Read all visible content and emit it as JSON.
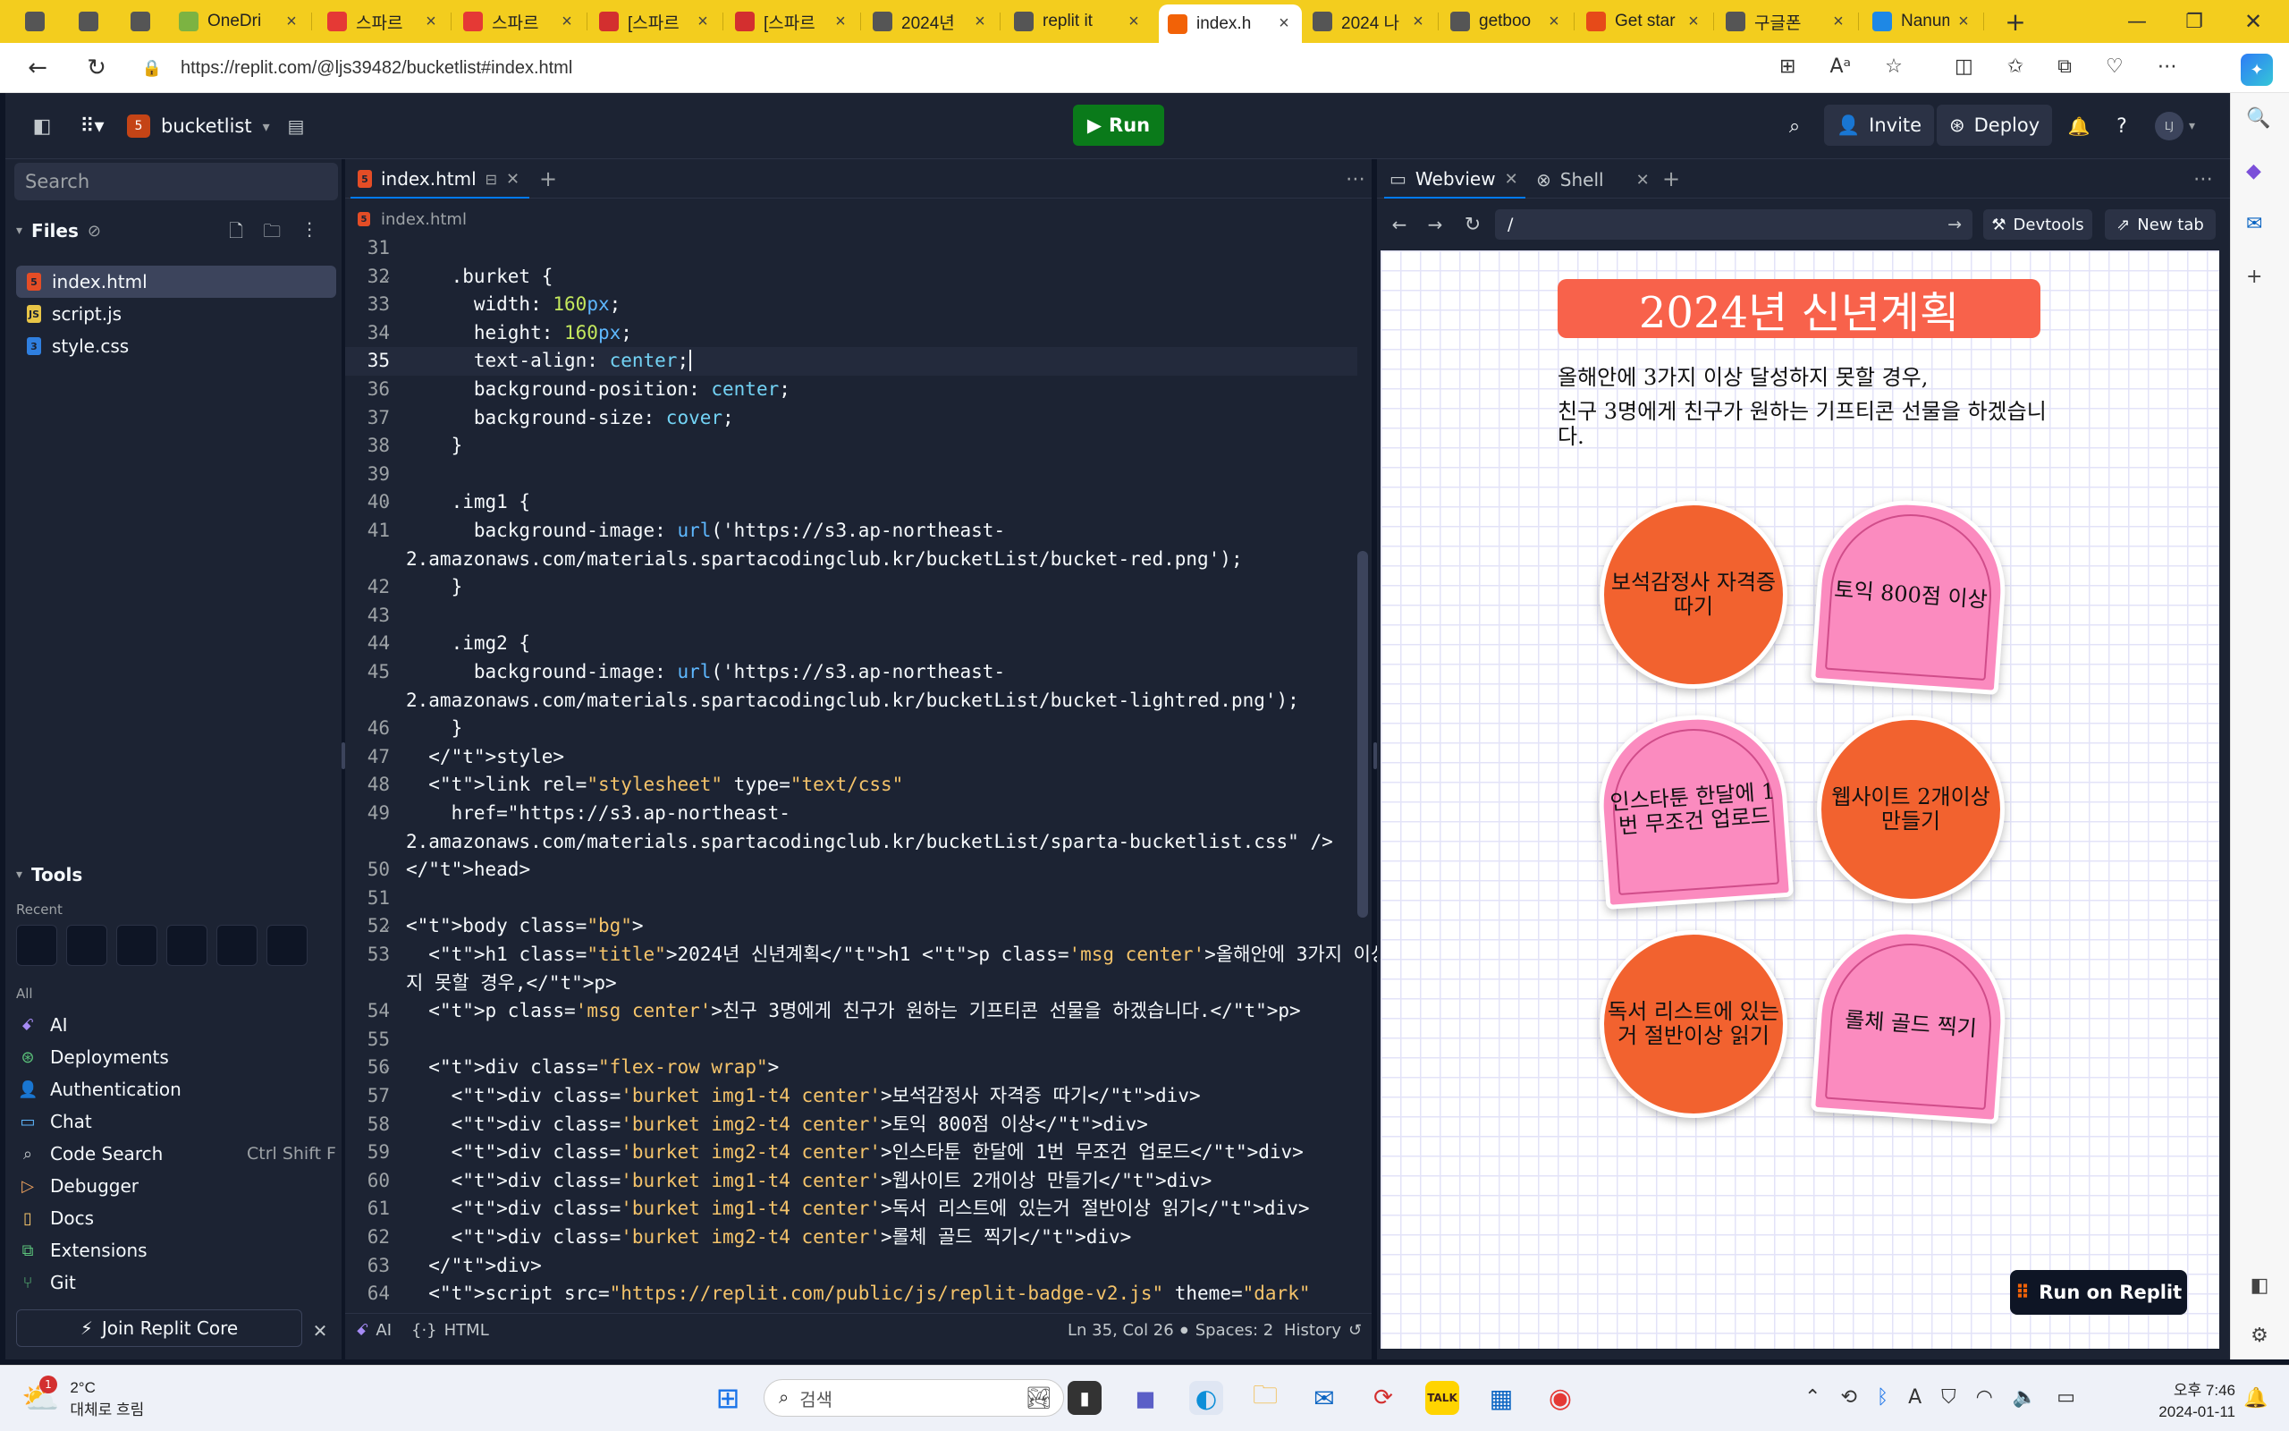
{
  "browser": {
    "tabs": [
      {
        "label": "",
        "color": "#555"
      },
      {
        "label": "",
        "color": "#555"
      },
      {
        "label": "",
        "color": "#555"
      },
      {
        "label": "OneDri",
        "color": "#7cb342"
      },
      {
        "label": "스파르",
        "color": "#e53935"
      },
      {
        "label": "스파르",
        "color": "#e53935"
      },
      {
        "label": "[스파르",
        "color": "#d32f2f"
      },
      {
        "label": "[스파르",
        "color": "#d32f2f"
      },
      {
        "label": "2024년",
        "color": "#555"
      },
      {
        "label": "replit it",
        "color": "#555"
      },
      {
        "label": "index.h",
        "color": "#f26207"
      },
      {
        "label": "2024 나",
        "color": "#555"
      },
      {
        "label": "getboo",
        "color": "#555"
      },
      {
        "label": "Get star",
        "color": "#e64a19"
      },
      {
        "label": "구글폰",
        "color": "#555"
      },
      {
        "label": "Nanum",
        "color": "#1e88e5"
      }
    ],
    "url": "https://replit.com/@ljs39482/bucketlist#index.html"
  },
  "replit": {
    "project_name": "bucketlist",
    "run_label": "Run",
    "invite_label": "Invite",
    "deploy_label": "Deploy",
    "avatar_initials": "LJ",
    "search_placeholder": "Search",
    "files_header": "Files",
    "files": [
      "index.html",
      "script.js",
      "style.css"
    ],
    "tools_header": "Tools",
    "recent_label": "Recent",
    "all_label": "All",
    "tools": [
      {
        "label": "AI",
        "icon": "ai-icon",
        "shortcut": ""
      },
      {
        "label": "Deployments",
        "icon": "deployments-icon",
        "shortcut": ""
      },
      {
        "label": "Authentication",
        "icon": "authentication-icon",
        "shortcut": ""
      },
      {
        "label": "Chat",
        "icon": "chat-icon",
        "shortcut": ""
      },
      {
        "label": "Code Search",
        "icon": "code-search-icon",
        "shortcut": "Ctrl Shift F"
      },
      {
        "label": "Debugger",
        "icon": "debugger-icon",
        "shortcut": ""
      },
      {
        "label": "Docs",
        "icon": "docs-icon",
        "shortcut": ""
      },
      {
        "label": "Extensions",
        "icon": "extensions-icon",
        "shortcut": ""
      },
      {
        "label": "Git",
        "icon": "git-icon",
        "shortcut": ""
      }
    ],
    "join_core": "Join Replit Core",
    "editor_tab": "index.html",
    "breadcrumb": "index.html",
    "status": {
      "ai": "AI",
      "lang": "HTML",
      "position": "Ln 35, Col 26",
      "spaces": "Spaces: 2",
      "history": "History"
    },
    "webview_tab": "Webview",
    "shell_tab": "Shell",
    "webview_path": "/",
    "devtools_label": "Devtools",
    "newtab_label": "New tab"
  },
  "code_lines": [
    {
      "n": "31",
      "text": ""
    },
    {
      "n": "32",
      "text": "    .burket {",
      "fold": true
    },
    {
      "n": "33",
      "text": "      width: 160px;"
    },
    {
      "n": "34",
      "text": "      height: 160px;"
    },
    {
      "n": "35",
      "text": "      text-align: center;",
      "current": true
    },
    {
      "n": "36",
      "text": "      background-position: center;"
    },
    {
      "n": "37",
      "text": "      background-size: cover;"
    },
    {
      "n": "38",
      "text": "    }"
    },
    {
      "n": "39",
      "text": ""
    },
    {
      "n": "40",
      "text": "    .img1 {",
      "fold": true
    },
    {
      "n": "41",
      "text": "      background-image: url('https://s3.ap-northeast-"
    },
    {
      "n": "",
      "text": "2.amazonaws.com/materials.spartacodingclub.kr/bucketList/bucket-red.png');"
    },
    {
      "n": "42",
      "text": "    }"
    },
    {
      "n": "43",
      "text": ""
    },
    {
      "n": "44",
      "text": "    .img2 {",
      "fold": true
    },
    {
      "n": "45",
      "text": "      background-image: url('https://s3.ap-northeast-"
    },
    {
      "n": "",
      "text": "2.amazonaws.com/materials.spartacodingclub.kr/bucketList/bucket-lightred.png');"
    },
    {
      "n": "46",
      "text": "    }"
    },
    {
      "n": "47",
      "text": "  </style>"
    },
    {
      "n": "48",
      "text": "  <link rel=\"stylesheet\" type=\"text/css\""
    },
    {
      "n": "49",
      "text": "    href=\"https://s3.ap-northeast-"
    },
    {
      "n": "",
      "text": "2.amazonaws.com/materials.spartacodingclub.kr/bucketList/sparta-bucketlist.css\" />"
    },
    {
      "n": "50",
      "text": "</head>"
    },
    {
      "n": "51",
      "text": ""
    },
    {
      "n": "52",
      "text": "<body class=\"bg\">",
      "fold": true
    },
    {
      "n": "53",
      "text": "  <h1 class=\"title\">2024년 신년계획</h1 <p class='msg center'>올해안에 3가지 이상 달성하"
    },
    {
      "n": "",
      "text": "지 못할 경우,</p>"
    },
    {
      "n": "54",
      "text": "  <p class='msg center'>친구 3명에게 친구가 원하는 기프티콘 선물을 하겠습니다.</p>"
    },
    {
      "n": "55",
      "text": ""
    },
    {
      "n": "56",
      "text": "  <div class=\"flex-row wrap\">",
      "fold": true
    },
    {
      "n": "57",
      "text": "    <div class='burket img1-t4 center'>보석감정사 자격증 따기</div>"
    },
    {
      "n": "58",
      "text": "    <div class='burket img2-t4 center'>토익 800점 이상</div>"
    },
    {
      "n": "59",
      "text": "    <div class='burket img2-t4 center'>인스타툰 한달에 1번 무조건 업로드</div>"
    },
    {
      "n": "60",
      "text": "    <div class='burket img1-t4 center'>웹사이트 2개이상 만들기</div>"
    },
    {
      "n": "61",
      "text": "    <div class='burket img1-t4 center'>독서 리스트에 있는거 절반이상 읽기</div>"
    },
    {
      "n": "62",
      "text": "    <div class='burket img2-t4 center'>롤체 골드 찍기</div>"
    },
    {
      "n": "63",
      "text": "  </div>"
    },
    {
      "n": "64",
      "text": "  <script src=\"https://replit.com/public/js/replit-badge-v2.js\" theme=\"dark\""
    }
  ],
  "preview": {
    "title": "2024년 신년계획",
    "msg1": "올해안에 3가지 이상 달성하지 못할 경우,",
    "msg2": "친구 3명에게 친구가 원하는 기프티콘 선물을 하겠습니다.",
    "buckets": [
      {
        "text": "보석감정사 자격증 따기",
        "style": "red"
      },
      {
        "text": "토익 800점 이상",
        "style": "pink"
      },
      {
        "text": "인스타툰 한달에 1번 무조건 업로드",
        "style": "pink"
      },
      {
        "text": "웹사이트 2개이상 만들기",
        "style": "red"
      },
      {
        "text": "독서 리스트에 있는거 절반이상 읽기",
        "style": "red"
      },
      {
        "text": "롤체 골드 찍기",
        "style": "pink"
      }
    ],
    "run_on_replit": "Run on Replit"
  },
  "taskbar": {
    "weather_temp": "2°C",
    "weather_desc": "대체로 흐림",
    "weather_badge": "1",
    "search_placeholder": "검색",
    "time": "오후 7:46",
    "date": "2024-01-11"
  }
}
